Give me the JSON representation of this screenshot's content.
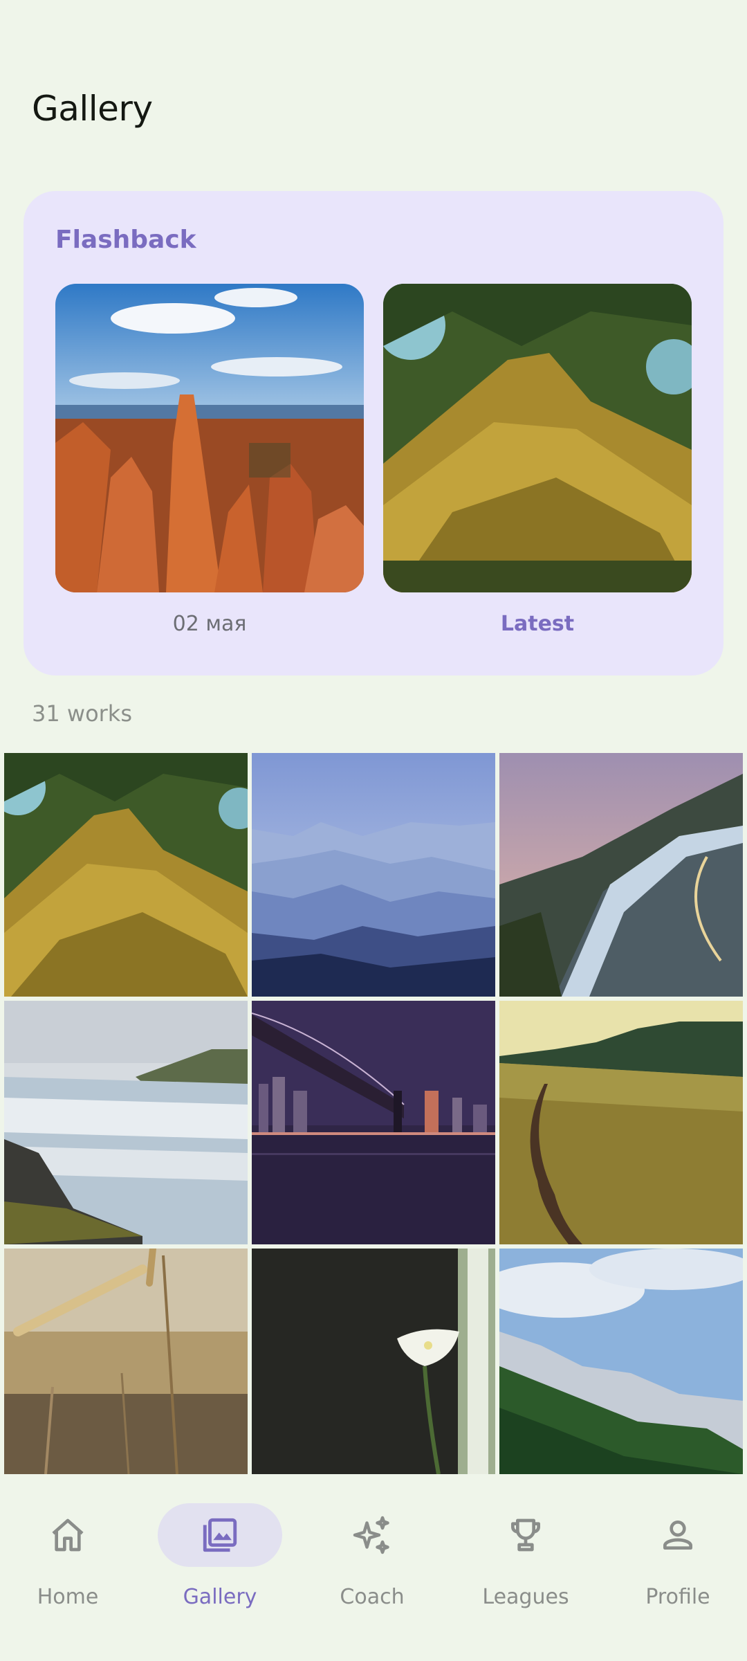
{
  "header": {
    "title": "Gallery"
  },
  "flashback": {
    "title": "Flashback",
    "photos": [
      {
        "image": "red-rock-canyon-hoodoos",
        "caption": "02 мая"
      },
      {
        "image": "mossy-branch-closeup",
        "caption": "Latest"
      }
    ]
  },
  "works": {
    "count_label": "31 works"
  },
  "grid": {
    "items": [
      {
        "image": "mossy-branch-closeup"
      },
      {
        "image": "blue-misty-mountains"
      },
      {
        "image": "mountain-road-guardrail"
      },
      {
        "image": "waterfall-long-exposure"
      },
      {
        "image": "bridge-city-night"
      },
      {
        "image": "meadow-path-forest"
      },
      {
        "image": "wheat-ears-closeup"
      },
      {
        "image": "white-calla-lily-dark"
      },
      {
        "image": "forest-mountain-sky"
      }
    ]
  },
  "nav": {
    "items": [
      {
        "label": "Home",
        "icon": "home-icon",
        "active": false
      },
      {
        "label": "Gallery",
        "icon": "gallery-icon",
        "active": true
      },
      {
        "label": "Coach",
        "icon": "sparkle-icon",
        "active": false
      },
      {
        "label": "Leagues",
        "icon": "trophy-icon",
        "active": false
      },
      {
        "label": "Profile",
        "icon": "person-icon",
        "active": false
      }
    ]
  },
  "colors": {
    "background": "#eff5ea",
    "card": "#e9e5fb",
    "accent": "#7a6cc0",
    "muted_text": "#8b8f8a"
  }
}
